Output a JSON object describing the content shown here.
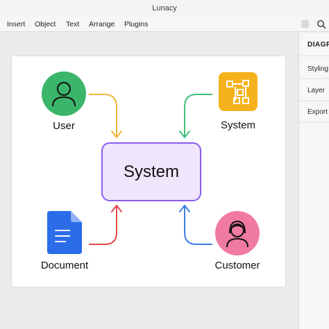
{
  "window": {
    "title": "Lunacy"
  },
  "menu": {
    "items": [
      "Insert",
      "Object",
      "Text",
      "Arrange",
      "Plugins"
    ]
  },
  "right_panel": {
    "title": "DIAGRAMS",
    "items": [
      "Styling",
      "Layer",
      "Export"
    ]
  },
  "diagram": {
    "center_label": "System",
    "nodes": {
      "user": "User",
      "system": "System",
      "document": "Document",
      "customer": "Customer"
    }
  },
  "colors": {
    "user_circle": "#3bb56a",
    "system_tile": "#f5b21c",
    "document_icon": "#2b6de8",
    "customer_circle": "#f07aa2",
    "center_fill": "#efe6fb",
    "center_border": "#8a5cf0",
    "arrow_user": "#f2b33d",
    "arrow_system": "#3ec07a",
    "arrow_document": "#e04848",
    "arrow_customer": "#3b7be4"
  }
}
